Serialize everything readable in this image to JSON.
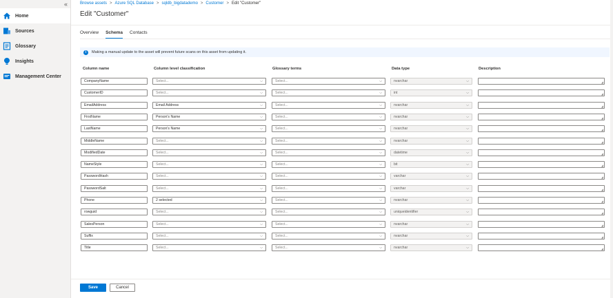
{
  "sidebar": {
    "collapse_glyph": "«",
    "items": [
      {
        "label": "Home",
        "icon": "home-icon"
      },
      {
        "label": "Sources",
        "icon": "sources-icon"
      },
      {
        "label": "Glossary",
        "icon": "glossary-icon"
      },
      {
        "label": "Insights",
        "icon": "insights-icon"
      },
      {
        "label": "Management Center",
        "icon": "management-icon"
      }
    ]
  },
  "breadcrumb": [
    "Browse assets",
    "Azure SQL Database",
    "sqldb_bigdatademo",
    "Customer",
    "Edit \"Customer\""
  ],
  "page_title": "Edit \"Customer\"",
  "tabs": [
    "Overview",
    "Schema",
    "Contacts"
  ],
  "info_message": "Making a manual update to the asset will prevent future scans on this asset from updating it.",
  "columns": {
    "name": "Column name",
    "classification": "Column level classification",
    "glossary": "Glossary terms",
    "datatype": "Data type",
    "description": "Description"
  },
  "rows": [
    {
      "name": "CompanyName",
      "classification": "Select...",
      "glossary": "Select...",
      "datatype": "nvarchar"
    },
    {
      "name": "CustomerID",
      "classification": "Select...",
      "glossary": "Select...",
      "datatype": "int"
    },
    {
      "name": "EmailAddress",
      "classification": "Email Address",
      "glossary": "Select...",
      "datatype": "nvarchar"
    },
    {
      "name": "FirstName",
      "classification": "Person's Name",
      "glossary": "Select...",
      "datatype": "nvarchar"
    },
    {
      "name": "LastName",
      "classification": "Person's Name",
      "glossary": "Select...",
      "datatype": "nvarchar"
    },
    {
      "name": "MiddleName",
      "classification": "Select...",
      "glossary": "Select...",
      "datatype": "nvarchar"
    },
    {
      "name": "ModifiedDate",
      "classification": "Select...",
      "glossary": "Select...",
      "datatype": "datetime"
    },
    {
      "name": "NameStyle",
      "classification": "Select...",
      "glossary": "Select...",
      "datatype": "bit"
    },
    {
      "name": "PasswordHash",
      "classification": "Select...",
      "glossary": "Select...",
      "datatype": "varchar"
    },
    {
      "name": "PasswordSalt",
      "classification": "Select...",
      "glossary": "Select...",
      "datatype": "varchar"
    },
    {
      "name": "Phone",
      "classification": "2 selected",
      "glossary": "Select...",
      "datatype": "nvarchar"
    },
    {
      "name": "rowguid",
      "classification": "Select...",
      "glossary": "Select...",
      "datatype": "uniqueidentifier"
    },
    {
      "name": "SalesPerson",
      "classification": "Select...",
      "glossary": "Select...",
      "datatype": "nvarchar"
    },
    {
      "name": "Suffix",
      "classification": "Select...",
      "glossary": "Select...",
      "datatype": "nvarchar"
    },
    {
      "name": "Title",
      "classification": "Select...",
      "glossary": "Select...",
      "datatype": "nvarchar"
    }
  ],
  "buttons": {
    "save": "Save",
    "cancel": "Cancel"
  },
  "colors": {
    "accent": "#0078d4",
    "sidebar_bg": "#f3f2f1"
  }
}
